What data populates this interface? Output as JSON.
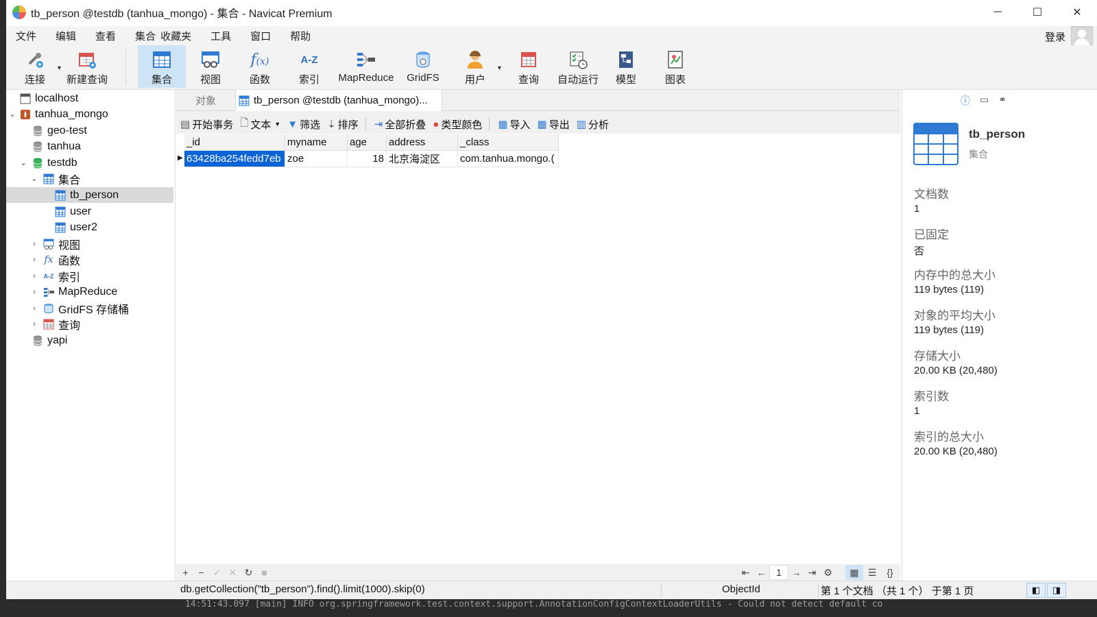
{
  "window": {
    "title": "tb_person @testdb (tanhua_mongo) - 集合 - Navicat Premium",
    "controls": [
      "─",
      "☐",
      "✕"
    ]
  },
  "menu": {
    "items": [
      "文件",
      "编辑",
      "查看",
      "集合",
      "收藏夹",
      "工具",
      "窗口",
      "帮助"
    ],
    "login": "登录"
  },
  "toolbar": {
    "buttons": [
      {
        "label": "连接",
        "icon": "connection-icon"
      },
      {
        "label": "新建查询",
        "icon": "new-query-icon"
      },
      {
        "label": "集合",
        "icon": "collection-icon",
        "active": true
      },
      {
        "label": "视图",
        "icon": "view-icon"
      },
      {
        "label": "函数",
        "icon": "function-icon"
      },
      {
        "label": "索引",
        "icon": "index-icon"
      },
      {
        "label": "MapReduce",
        "icon": "mapreduce-icon"
      },
      {
        "label": "GridFS",
        "icon": "gridfs-icon"
      },
      {
        "label": "用户",
        "icon": "user-icon"
      },
      {
        "label": "查询",
        "icon": "query-icon"
      },
      {
        "label": "自动运行",
        "icon": "automation-icon"
      },
      {
        "label": "模型",
        "icon": "model-icon"
      },
      {
        "label": "图表",
        "icon": "chart-icon"
      }
    ]
  },
  "tree": {
    "nodes": [
      {
        "label": "localhost"
      },
      {
        "label": "tanhua_mongo"
      },
      {
        "label": "geo-test"
      },
      {
        "label": "tanhua"
      },
      {
        "label": "testdb"
      },
      {
        "label": "集合"
      },
      {
        "label": "tb_person",
        "selected": true
      },
      {
        "label": "user"
      },
      {
        "label": "user2"
      },
      {
        "label": "视图"
      },
      {
        "label": "函数"
      },
      {
        "label": "索引"
      },
      {
        "label": "MapReduce"
      },
      {
        "label": "GridFS 存储桶"
      },
      {
        "label": "查询"
      },
      {
        "label": "yapi"
      }
    ]
  },
  "tabs": {
    "objects": "对象",
    "document": "tb_person @testdb (tanhua_mongo)..."
  },
  "subtoolbar": {
    "begin_tx": "开始事务",
    "text": "文本",
    "filter": "筛选",
    "sort": "排序",
    "collapse_all": "全部折叠",
    "type_color": "类型颜色",
    "import": "导入",
    "export": "导出",
    "analyze": "分析"
  },
  "grid": {
    "columns": [
      "_id",
      "myname",
      "age",
      "address",
      "_class"
    ],
    "rows": [
      {
        "_id": "63428ba254fedd7eb",
        "myname": "zoe",
        "age": "18",
        "address": "北京海淀区",
        "_class": "com.tanhua.mongo.("
      }
    ]
  },
  "pager": {
    "page": "1"
  },
  "info": {
    "name": "tb_person",
    "type": "集合",
    "fields": [
      {
        "label": "文档数",
        "value": "1"
      },
      {
        "label": "已固定",
        "value": "否"
      },
      {
        "label": "内存中的总大小",
        "value": "119 bytes (119)"
      },
      {
        "label": "对象的平均大小",
        "value": "119 bytes (119)"
      },
      {
        "label": "存储大小",
        "value": "20.00 KB (20,480)"
      },
      {
        "label": "索引数",
        "value": "1"
      },
      {
        "label": "索引的总大小",
        "value": "20.00 KB (20,480)"
      }
    ]
  },
  "status": {
    "query": "db.getCollection(\"tb_person\").find().limit(1000).skip(0)",
    "type": "ObjectId",
    "record": "第 1 个文档 （共 1 个） 于第 1 页"
  },
  "console_text": "14:51:43.097 [main] INFO org.springframework.test.context.support.AnnotationConfigContextLoaderUtils - Could not detect default co",
  "colors": {
    "accent": "#0a64d6",
    "active_toolbar": "#cde4f7",
    "selected_tree": "#dadada"
  }
}
